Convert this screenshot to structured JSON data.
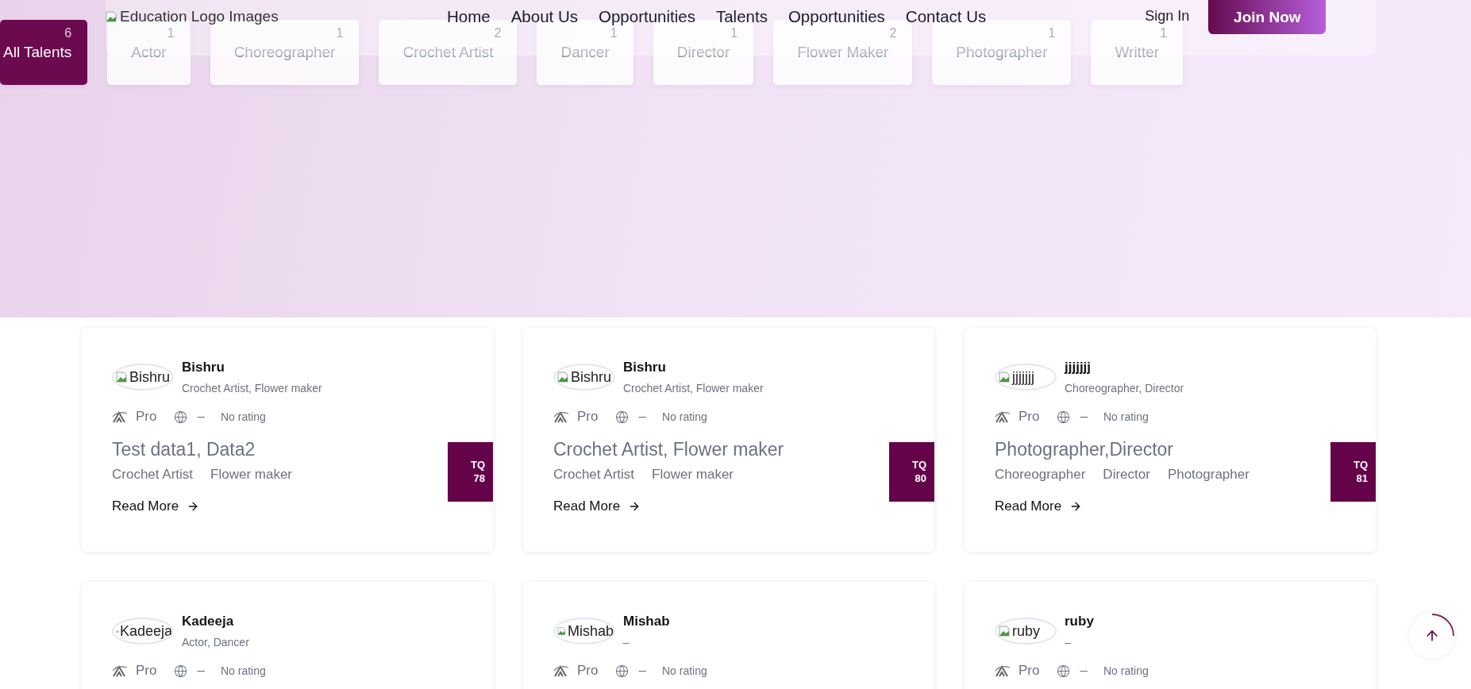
{
  "header": {
    "logo_alt": "Education Logo Images",
    "nav": [
      "Home",
      "About Us",
      "Opportunities",
      "Talents",
      "Opportunities",
      "Contact Us"
    ],
    "sign_in": "Sign In",
    "join_button": "Join Now"
  },
  "tabs": [
    {
      "label": "All Talents",
      "count": "6",
      "selected": true
    },
    {
      "label": "Actor",
      "count": "1",
      "selected": false
    },
    {
      "label": "Choreographer",
      "count": "1",
      "selected": false
    },
    {
      "label": "Crochet Artist",
      "count": "2",
      "selected": false
    },
    {
      "label": "Dancer",
      "count": "1",
      "selected": false
    },
    {
      "label": "Director",
      "count": "1",
      "selected": false
    },
    {
      "label": "Flower Maker",
      "count": "2",
      "selected": false
    },
    {
      "label": "Photographer",
      "count": "1",
      "selected": false
    },
    {
      "label": "Writter",
      "count": "1",
      "selected": false
    }
  ],
  "cards": [
    {
      "avatar_alt": "Bishru",
      "name": "Bishru",
      "roles": "Crochet Artist, Flower maker",
      "plan": "Pro",
      "website": "–",
      "rating": "No rating",
      "title": "Test data1, Data2",
      "tags": [
        "Crochet Artist",
        "Flower maker"
      ],
      "read_more": "Read More",
      "tq_label": "TQ",
      "tq_value": "78"
    },
    {
      "avatar_alt": "Bishru",
      "name": "Bishru",
      "roles": "Crochet Artist, Flower maker",
      "plan": "Pro",
      "website": "–",
      "rating": "No rating",
      "title": "Crochet Artist, Flower maker",
      "tags": [
        "Crochet Artist",
        "Flower maker"
      ],
      "read_more": "Read More",
      "tq_label": "TQ",
      "tq_value": "80"
    },
    {
      "avatar_alt": "jjjjjjj",
      "name": "jjjjjjj",
      "roles": "Choreographer, Director",
      "plan": "Pro",
      "website": "–",
      "rating": "No rating",
      "title": "Photographer,Director",
      "tags": [
        "Choreographer",
        "Director",
        "Photographer"
      ],
      "read_more": "Read More",
      "tq_label": "TQ",
      "tq_value": "81"
    },
    {
      "avatar_alt": "Kadeeja",
      "name": "Kadeeja",
      "roles": "Actor, Dancer",
      "plan": "Pro",
      "website": "–",
      "rating": "No rating"
    },
    {
      "avatar_alt": "Mishab",
      "name": "Mishab",
      "roles": "–",
      "plan": "Pro",
      "website": "–",
      "rating": "No rating"
    },
    {
      "avatar_alt": "ruby",
      "name": "ruby",
      "roles": "–",
      "plan": "Pro",
      "website": "–",
      "rating": "No rating"
    }
  ]
}
